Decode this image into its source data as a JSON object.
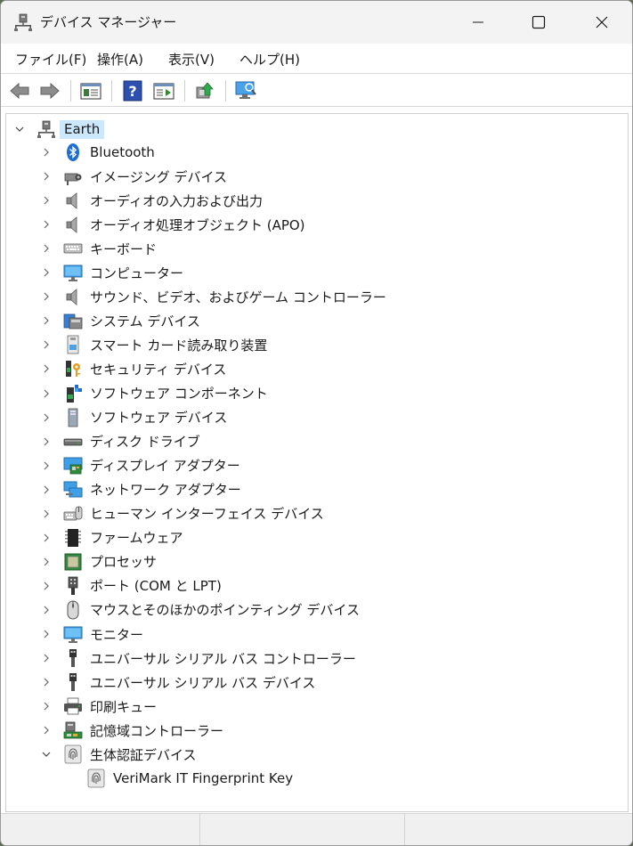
{
  "window": {
    "title": "デバイス マネージャー",
    "controls": {
      "minimize": "minimize",
      "maximize": "maximize",
      "close": "close"
    }
  },
  "menu": [
    {
      "label": "ファイル(F)"
    },
    {
      "label": "操作(A)"
    },
    {
      "label": "表示(V)"
    },
    {
      "label": "ヘルプ(H)"
    }
  ],
  "toolbar": {
    "buttons": [
      "back-arrow-icon",
      "forward-arrow-icon",
      "properties-icon",
      "help-icon",
      "view-pane-icon",
      "update-driver-icon",
      "scan-hardware-icon"
    ]
  },
  "tree": {
    "root": {
      "label": "Earth",
      "icon": "computer-network-icon",
      "expanded": true
    },
    "categories": [
      {
        "label": "Bluetooth",
        "icon": "bluetooth-icon"
      },
      {
        "label": "イメージング デバイス",
        "icon": "camera-icon"
      },
      {
        "label": "オーディオの入力および出力",
        "icon": "speaker-icon"
      },
      {
        "label": "オーディオ処理オブジェクト (APO)",
        "icon": "speaker-icon"
      },
      {
        "label": "キーボード",
        "icon": "keyboard-icon"
      },
      {
        "label": "コンピューター",
        "icon": "monitor-icon"
      },
      {
        "label": "サウンド、ビデオ、およびゲーム コントローラー",
        "icon": "speaker-icon"
      },
      {
        "label": "システム デバイス",
        "icon": "system-device-icon"
      },
      {
        "label": "スマート カード読み取り装置",
        "icon": "smart-card-icon"
      },
      {
        "label": "セキュリティ デバイス",
        "icon": "security-key-icon"
      },
      {
        "label": "ソフトウェア コンポーネント",
        "icon": "software-component-icon"
      },
      {
        "label": "ソフトウェア デバイス",
        "icon": "software-device-icon"
      },
      {
        "label": "ディスク ドライブ",
        "icon": "disk-drive-icon"
      },
      {
        "label": "ディスプレイ アダプター",
        "icon": "display-adapter-icon"
      },
      {
        "label": "ネットワーク アダプター",
        "icon": "network-adapter-icon"
      },
      {
        "label": "ヒューマン インターフェイス デバイス",
        "icon": "hid-icon"
      },
      {
        "label": "ファームウェア",
        "icon": "firmware-chip-icon"
      },
      {
        "label": "プロセッサ",
        "icon": "processor-icon"
      },
      {
        "label": "ポート (COM と LPT)",
        "icon": "port-icon"
      },
      {
        "label": "マウスとそのほかのポインティング デバイス",
        "icon": "mouse-icon"
      },
      {
        "label": "モニター",
        "icon": "monitor-icon"
      },
      {
        "label": "ユニバーサル シリアル バス コントローラー",
        "icon": "usb-icon"
      },
      {
        "label": "ユニバーサル シリアル バス デバイス",
        "icon": "usb-icon"
      },
      {
        "label": "印刷キュー",
        "icon": "printer-icon"
      },
      {
        "label": "記憶域コントローラー",
        "icon": "storage-controller-icon"
      },
      {
        "label": "生体認証デバイス",
        "icon": "fingerprint-icon",
        "expanded": true,
        "children": [
          {
            "label": "VeriMark IT Fingerprint Key",
            "icon": "fingerprint-icon"
          }
        ]
      }
    ]
  },
  "colors": {
    "selection": "#cce8ff",
    "accent": "#1f6fd1",
    "text": "#1a1a1a"
  }
}
